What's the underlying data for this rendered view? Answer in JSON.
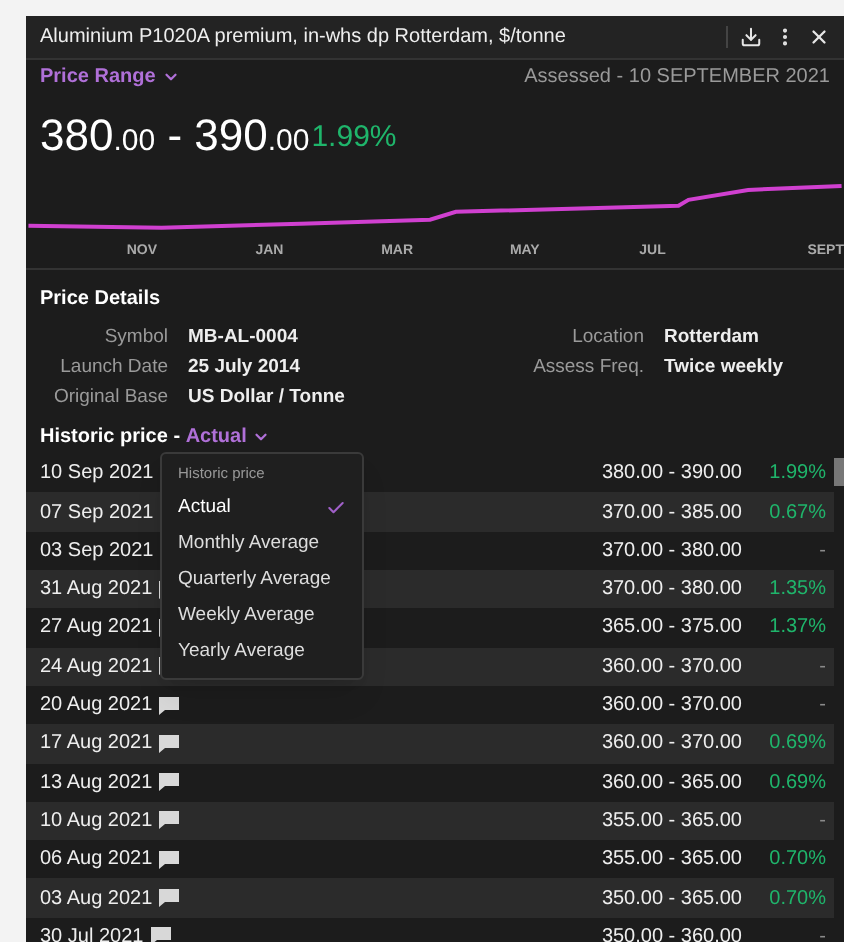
{
  "window": {
    "title": "Aluminium P1020A premium, in-whs dp Rotterdam, $/tonne"
  },
  "subheader": {
    "range_label": "Price Range",
    "assessed": "Assessed - 10 SEPTEMBER 2021"
  },
  "price": {
    "parts": [
      {
        "kind": "int",
        "text": "380"
      },
      {
        "kind": "dec",
        "text": ".00"
      },
      {
        "kind": "sep",
        "text": " - "
      },
      {
        "kind": "int",
        "text": "390"
      },
      {
        "kind": "dec",
        "text": ".00"
      }
    ],
    "change": "1.99%"
  },
  "chart": {
    "months": [
      "NOV",
      "JAN",
      "MAR",
      "MAY",
      "JUL",
      "SEPT"
    ]
  },
  "details": {
    "title": "Price Details",
    "fields": [
      {
        "label": "Symbol",
        "value": "MB-AL-0004"
      },
      {
        "label": "Location",
        "value": "Rotterdam"
      },
      {
        "label": "Launch Date",
        "value": "25 July 2014"
      },
      {
        "label": "Assess Freq.",
        "value": "Twice weekly"
      },
      {
        "label": "Original Base",
        "value": "US Dollar / Tonne"
      }
    ]
  },
  "historic": {
    "label": "Historic price - ",
    "mode": "Actual"
  },
  "menu": {
    "header": "Historic price",
    "items": [
      {
        "label": "Actual",
        "selected": true
      },
      {
        "label": "Monthly Average",
        "selected": false
      },
      {
        "label": "Quarterly Average",
        "selected": false
      },
      {
        "label": "Weekly Average",
        "selected": false
      },
      {
        "label": "Yearly Average",
        "selected": false
      }
    ]
  },
  "rows": [
    {
      "date": "10 Sep 2021",
      "range": "380.00 - 390.00",
      "change": "1.99%",
      "kind": "up"
    },
    {
      "date": "07 Sep 2021",
      "range": "370.00 - 385.00",
      "change": "0.67%",
      "kind": "up"
    },
    {
      "date": "03 Sep 2021",
      "range": "370.00 - 380.00",
      "change": "-",
      "kind": "flat"
    },
    {
      "date": "31 Aug 2021",
      "range": "370.00 - 380.00",
      "change": "1.35%",
      "kind": "up"
    },
    {
      "date": "27 Aug 2021",
      "range": "365.00 - 375.00",
      "change": "1.37%",
      "kind": "up"
    },
    {
      "date": "24 Aug 2021",
      "range": "360.00 - 370.00",
      "change": "-",
      "kind": "flat"
    },
    {
      "date": "20 Aug 2021",
      "range": "360.00 - 370.00",
      "change": "-",
      "kind": "flat"
    },
    {
      "date": "17 Aug 2021",
      "range": "360.00 - 370.00",
      "change": "0.69%",
      "kind": "up"
    },
    {
      "date": "13 Aug 2021",
      "range": "360.00 - 365.00",
      "change": "0.69%",
      "kind": "up"
    },
    {
      "date": "10 Aug 2021",
      "range": "355.00 - 365.00",
      "change": "-",
      "kind": "flat"
    },
    {
      "date": "06 Aug 2021",
      "range": "355.00 - 365.00",
      "change": "0.70%",
      "kind": "up"
    },
    {
      "date": "03 Aug 2021",
      "range": "350.00 - 365.00",
      "change": "0.70%",
      "kind": "up"
    },
    {
      "date": "30 Jul 2021",
      "range": "350.00 - 360.00",
      "change": "-",
      "kind": "flat"
    }
  ]
}
